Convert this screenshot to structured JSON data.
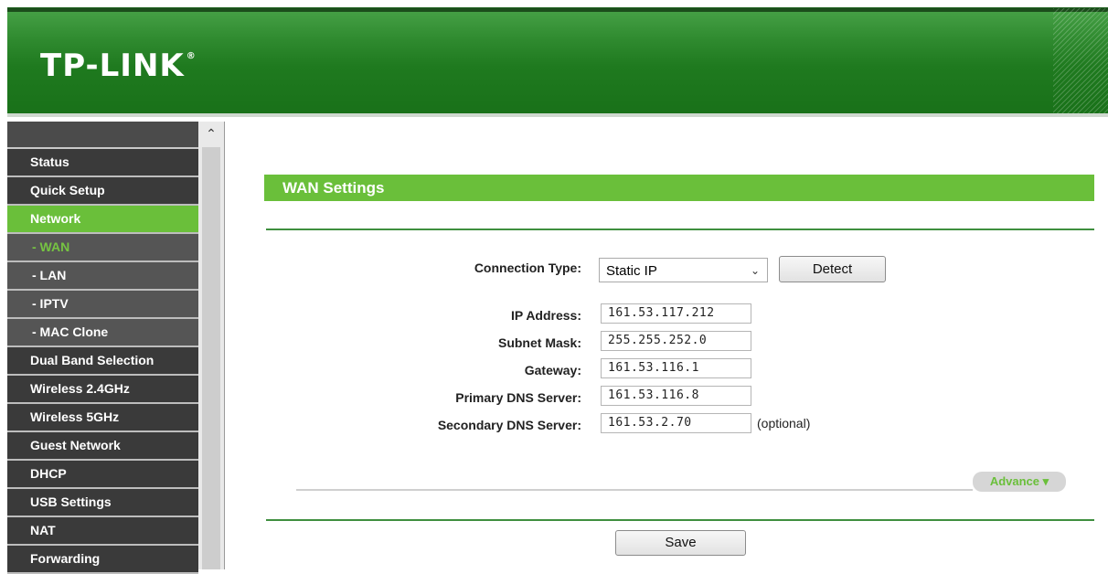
{
  "brand": {
    "logo_text": "TP-LINK",
    "registered_mark": "®"
  },
  "colors": {
    "header_green": "#2f8a2f",
    "accent_green": "#6abf3a",
    "menu_bg": "#3a3a3a"
  },
  "sidebar": {
    "items": [
      {
        "label": "Status",
        "type": "main",
        "active": false
      },
      {
        "label": "Quick Setup",
        "type": "main",
        "active": false
      },
      {
        "label": "Network",
        "type": "main",
        "active": true
      },
      {
        "label": "- WAN",
        "type": "sub",
        "active": true
      },
      {
        "label": "- LAN",
        "type": "sub",
        "active": false
      },
      {
        "label": "- IPTV",
        "type": "sub",
        "active": false
      },
      {
        "label": "- MAC Clone",
        "type": "sub",
        "active": false
      },
      {
        "label": "Dual Band Selection",
        "type": "main",
        "active": false
      },
      {
        "label": "Wireless 2.4GHz",
        "type": "main",
        "active": false
      },
      {
        "label": "Wireless 5GHz",
        "type": "main",
        "active": false
      },
      {
        "label": "Guest Network",
        "type": "main",
        "active": false
      },
      {
        "label": "DHCP",
        "type": "main",
        "active": false
      },
      {
        "label": "USB Settings",
        "type": "main",
        "active": false
      },
      {
        "label": "NAT",
        "type": "main",
        "active": false
      },
      {
        "label": "Forwarding",
        "type": "main",
        "active": false
      }
    ],
    "scroll_up_icon": "chevron-up-icon"
  },
  "wan": {
    "title": "WAN Settings",
    "connection_type_label": "Connection Type:",
    "connection_type_value": "Static IP",
    "detect_label": "Detect",
    "ip_label": "IP Address:",
    "ip_value": "161.53.117.212",
    "mask_label": "Subnet Mask:",
    "mask_value": "255.255.252.0",
    "gateway_label": "Gateway:",
    "gateway_value": "161.53.116.1",
    "dns1_label": "Primary DNS Server:",
    "dns1_value": "161.53.116.8",
    "dns2_label": "Secondary DNS Server:",
    "dns2_value": "161.53.2.70",
    "optional_text": "(optional)",
    "advance_label": "Advance",
    "save_label": "Save"
  }
}
